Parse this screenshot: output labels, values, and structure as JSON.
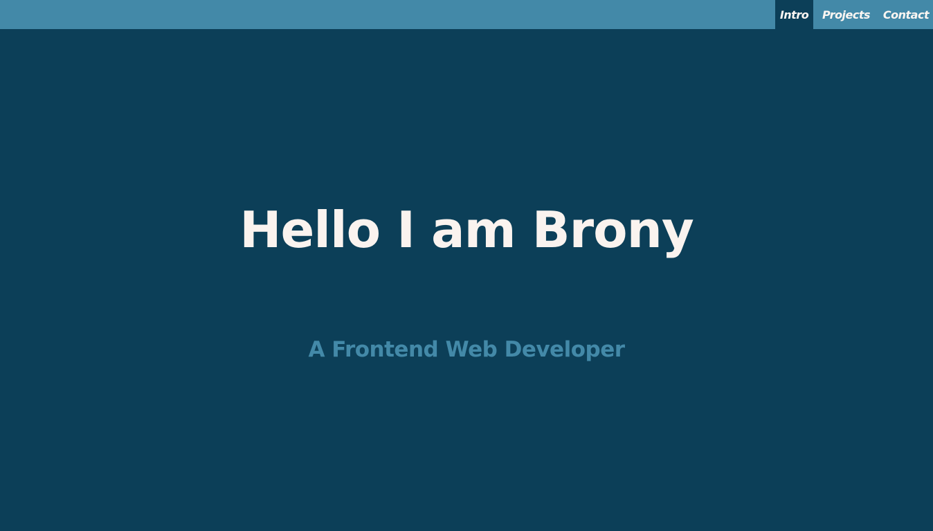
{
  "nav": {
    "items": [
      {
        "label": "Intro",
        "active": true
      },
      {
        "label": "Projects",
        "active": false
      },
      {
        "label": "Contact",
        "active": false
      }
    ]
  },
  "hero": {
    "title": "Hello I am Brony",
    "subtitle": "A Frontend Web Developer"
  },
  "colors": {
    "background": "#0c3f58",
    "navbar": "#4389a8",
    "title_text": "#faf3ef",
    "subtitle_text": "#4389a8"
  }
}
